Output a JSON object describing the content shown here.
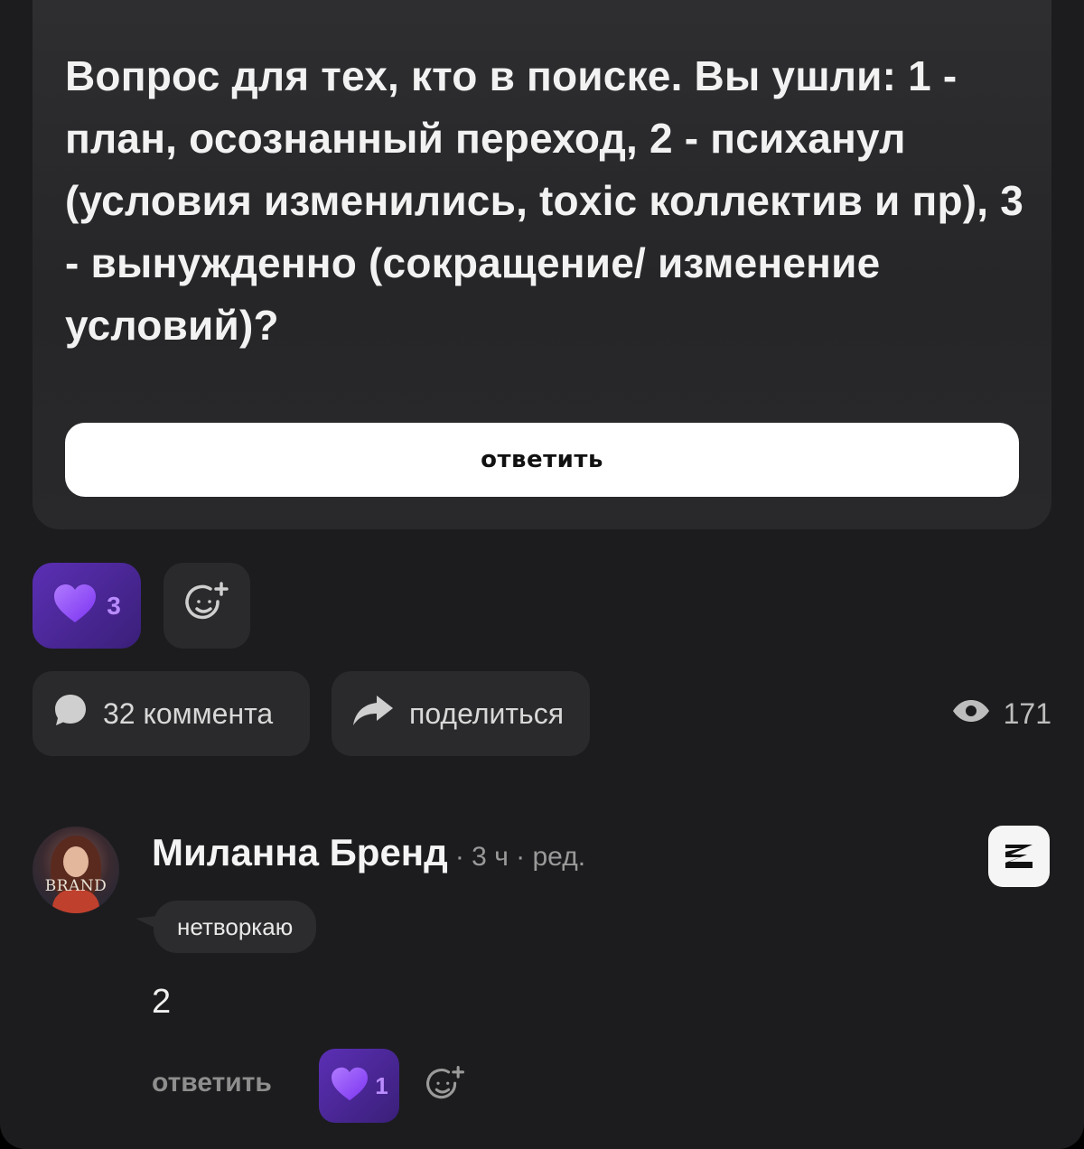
{
  "post": {
    "question": "Вопрос для тех, кто в поиске. Вы ушли: 1 - план, осознанный переход, 2 - психанул (условия изменились, toxic коллектив и пр), 3 - вынужденно (сокращение/ изменение условий)?",
    "answer_button": "ответить",
    "likes_count": "3",
    "comments_label": "32 коммента",
    "share_label": "поделиться",
    "views_count": "171"
  },
  "comment": {
    "author": "Миланна Бренд",
    "meta": "· 3 ч · ред.",
    "avatar_text": "BRAND",
    "tag": "нетворкаю",
    "body": "2",
    "reply_label": "ответить",
    "likes_count": "1"
  },
  "colors": {
    "background": "#1c1c1e",
    "card": "#2a2a2c",
    "accent_purple": "#5b2fb5",
    "heart": "#9b5cff"
  },
  "icons": {
    "heart": "heart-icon",
    "add_reaction": "add-reaction-icon",
    "comment": "comment-bubble-icon",
    "share": "share-arrow-icon",
    "views": "eye-icon",
    "platform": "platform-logo-icon"
  }
}
